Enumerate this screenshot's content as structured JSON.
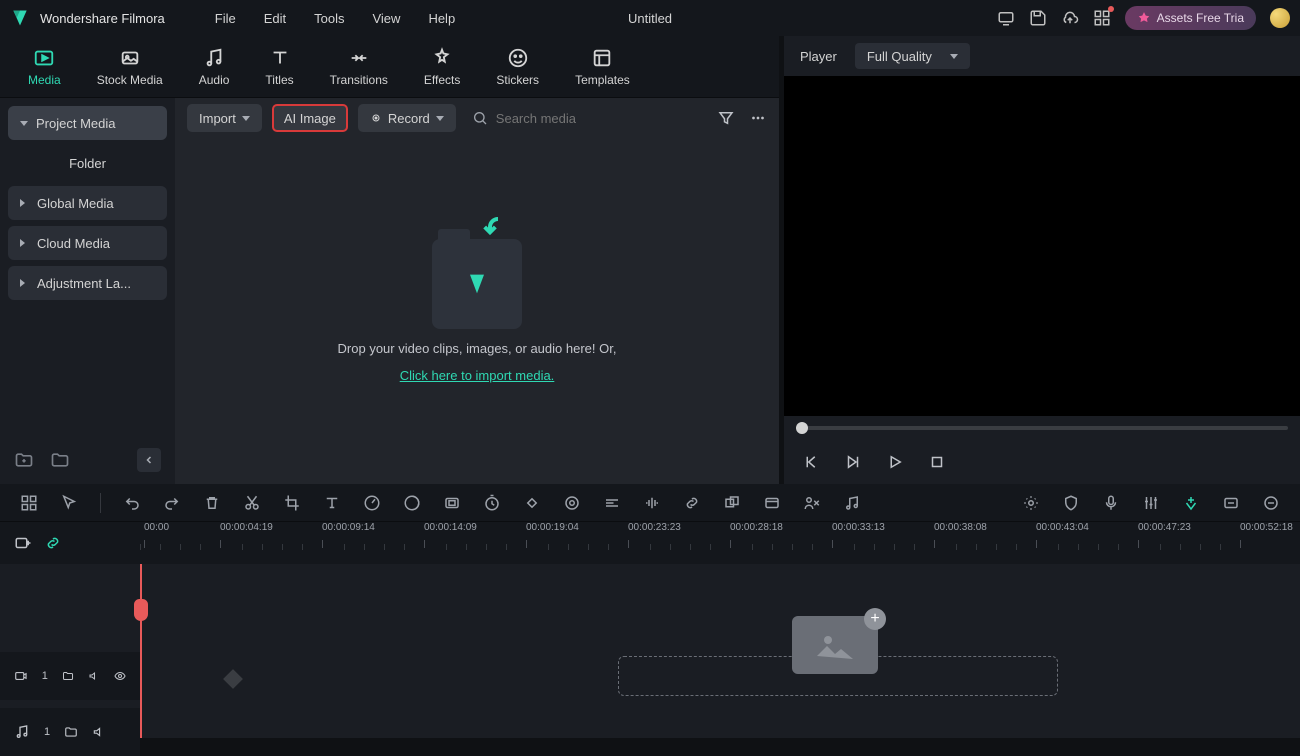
{
  "app": {
    "name": "Wondershare Filmora",
    "title": "Untitled"
  },
  "menubar": [
    "File",
    "Edit",
    "Tools",
    "View",
    "Help"
  ],
  "assets_pill": "Assets Free Tria",
  "tabs": [
    {
      "label": "Media"
    },
    {
      "label": "Stock Media"
    },
    {
      "label": "Audio"
    },
    {
      "label": "Titles"
    },
    {
      "label": "Transitions"
    },
    {
      "label": "Effects"
    },
    {
      "label": "Stickers"
    },
    {
      "label": "Templates"
    }
  ],
  "sidebar": {
    "project_media": "Project Media",
    "folder": "Folder",
    "global_media": "Global Media",
    "cloud_media": "Cloud Media",
    "adjustment": "Adjustment La..."
  },
  "toolbar": {
    "import": "Import",
    "ai_image": "AI Image",
    "record": "Record",
    "search_placeholder": "Search media"
  },
  "drop": {
    "line1": "Drop your video clips, images, or audio here! Or,",
    "link": "Click here to import media."
  },
  "player": {
    "label": "Player",
    "quality": "Full Quality"
  },
  "timeline": {
    "first": "00:00",
    "ticks": [
      "00:00:04:19",
      "00:00:09:14",
      "00:00:14:09",
      "00:00:19:04",
      "00:00:23:23",
      "00:00:28:18",
      "00:00:33:13",
      "00:00:38:08",
      "00:00:43:04",
      "00:00:47:23",
      "00:00:52:18"
    ],
    "track_video": "1",
    "track_audio": "1"
  }
}
